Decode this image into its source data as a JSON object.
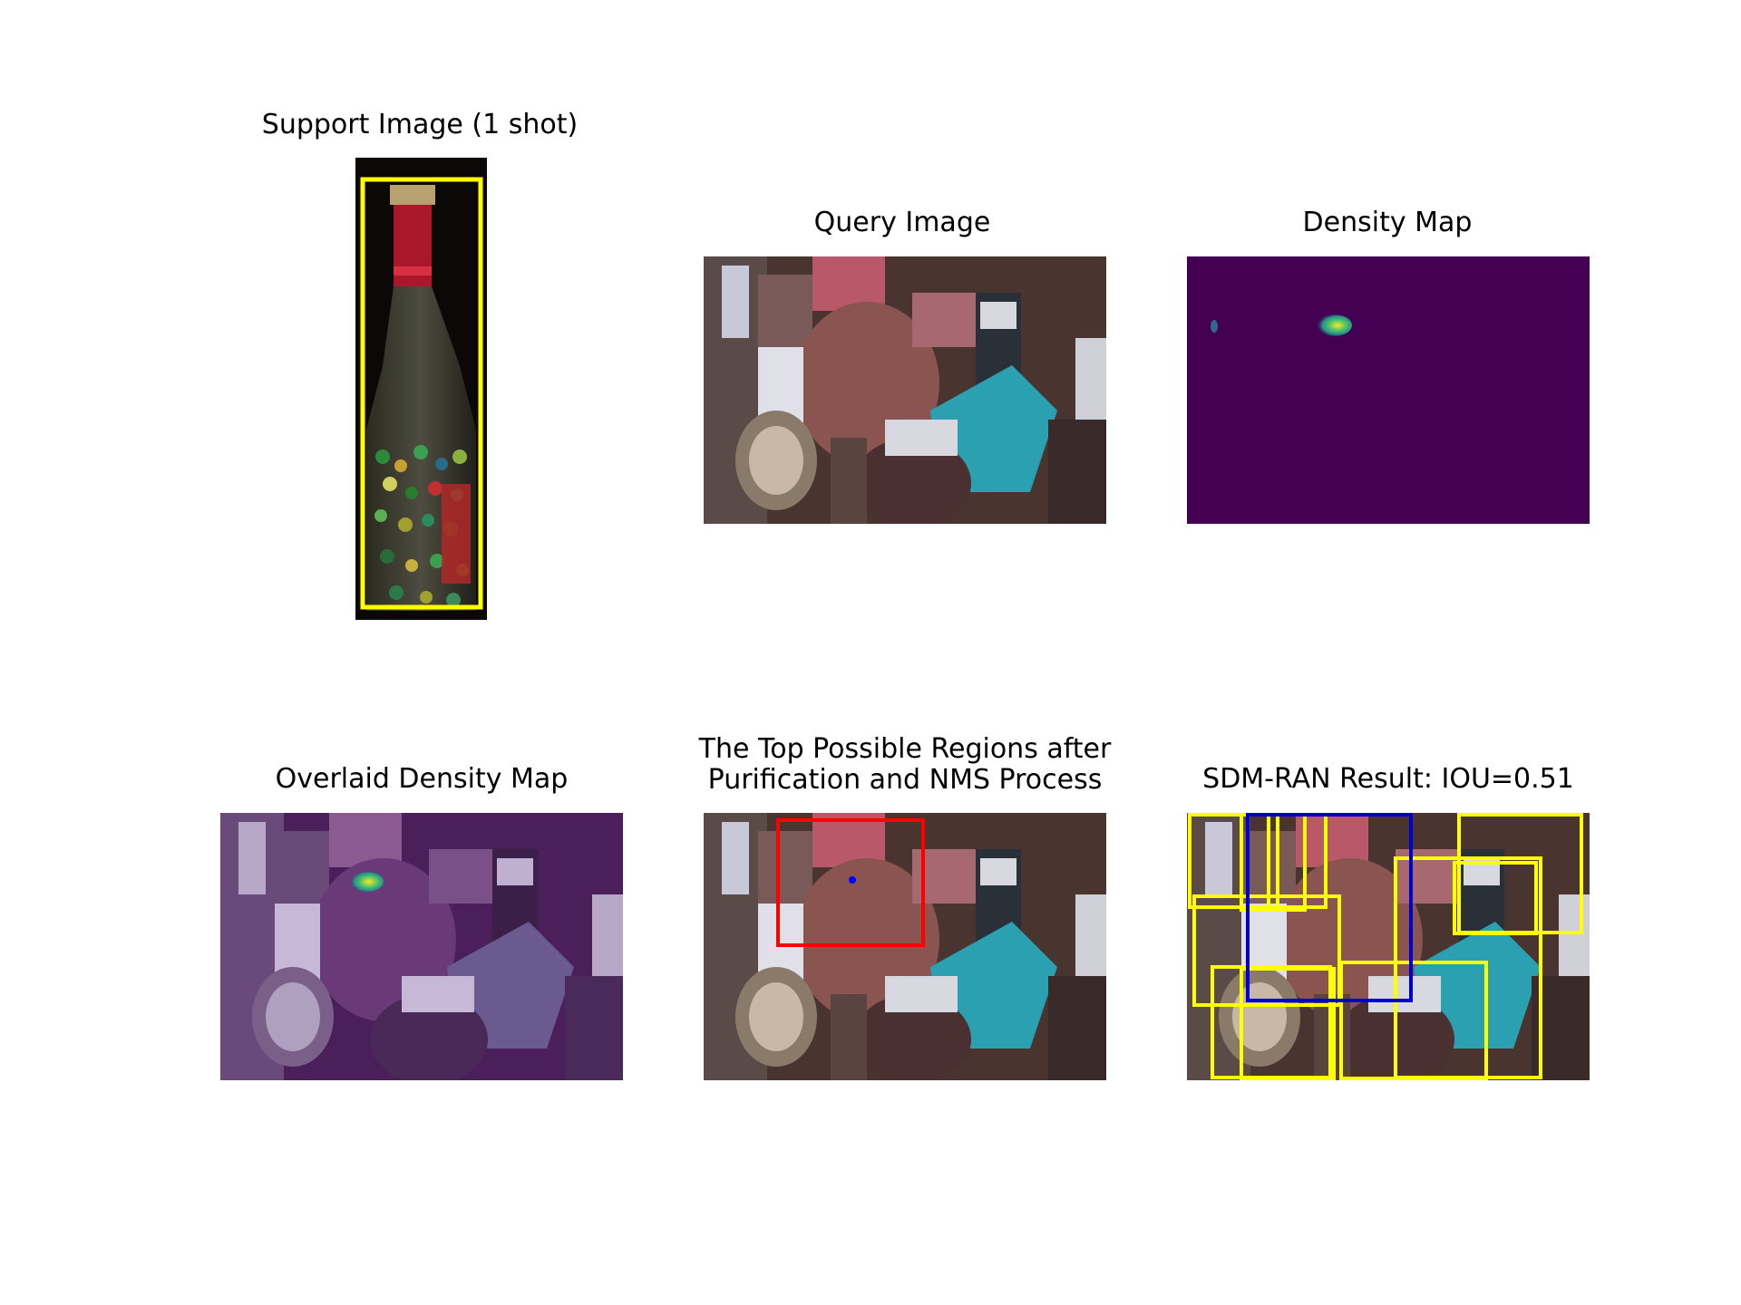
{
  "figure": {
    "panels": [
      {
        "id": "support",
        "title": "Support Image (1 shot)"
      },
      {
        "id": "query",
        "title": "Query Image"
      },
      {
        "id": "density",
        "title": "Density Map"
      },
      {
        "id": "overlaid",
        "title": "Overlaid Density Map"
      },
      {
        "id": "regions",
        "title_line1": "The Top Possible Regions after",
        "title_line2": "Purification and NMS Process"
      },
      {
        "id": "result",
        "title": "SDM-RAN Result: IOU=0.51"
      }
    ]
  },
  "colors": {
    "support_box": "#ffff00",
    "region_box": "#ff0000",
    "result_gt_box": "#0000cc",
    "result_pred_boxes": "#ffff00",
    "density_background": "#440154",
    "overlay_tint": "#5a2a6e"
  }
}
